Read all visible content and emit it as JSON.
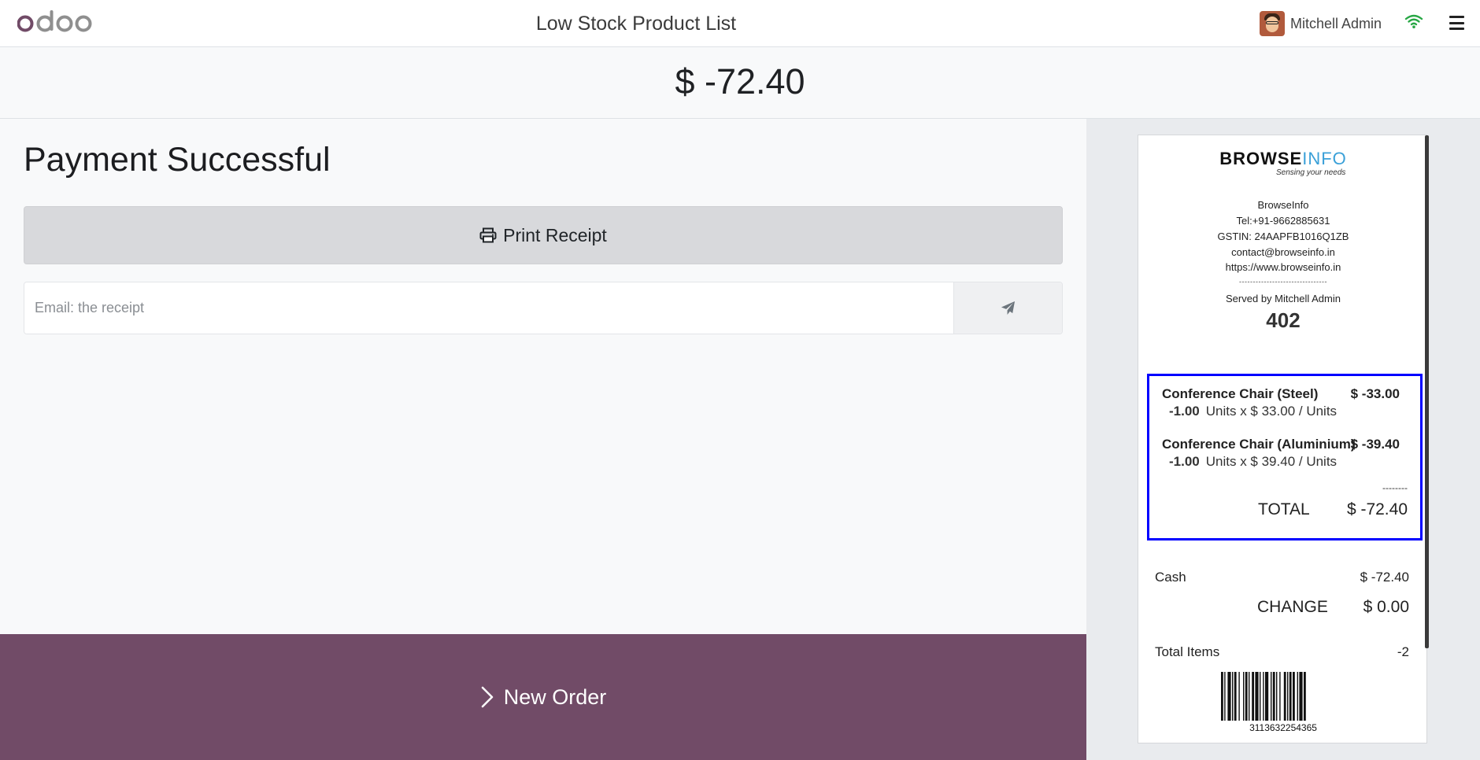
{
  "header": {
    "title": "Low Stock Product List",
    "user_name": "Mitchell Admin",
    "logo_text": "odoo"
  },
  "amount_due": "$ -72.40",
  "payment": {
    "title": "Payment Successful",
    "print_label": "Print Receipt",
    "email_placeholder": "Email: the receipt",
    "new_order_label": "New Order"
  },
  "receipt": {
    "brand_main": "BROWSE",
    "brand_accent": "INFO",
    "tagline": "Sensing your needs",
    "company_lines": [
      "BrowseInfo",
      "Tel:+91-9662885631",
      "GSTIN: 24AAPFB1016Q1ZB",
      "contact@browseinfo.in",
      "https://www.browseinfo.in"
    ],
    "divider": "--------------------------------",
    "served_by": "Served by Mitchell Admin",
    "order_number": "402",
    "lines": [
      {
        "product": "Conference Chair (Steel)",
        "price": "$ -33.00",
        "qty": "-1.00",
        "detail": "Units x $ 33.00 / Units"
      },
      {
        "product": "Conference Chair (Aluminium)",
        "price": "$ -39.40",
        "qty": "-1.00",
        "detail": "Units x $ 39.40 / Units"
      }
    ],
    "total_separator": "--------",
    "total_label": "TOTAL",
    "total_value": "$ -72.40",
    "payment_method": "Cash",
    "payment_value": "$ -72.40",
    "change_label": "CHANGE",
    "change_value": "$ 0.00",
    "total_items_label": "Total Items",
    "total_items_value": "-2",
    "barcode_number": "3113632254365"
  },
  "colors": {
    "brand_purple": "#714b67",
    "highlight_border": "#0000ff",
    "wifi_green": "#28a745",
    "info_blue": "#3aa0d8"
  },
  "icons": {
    "print": "print-icon",
    "send": "paper-plane-icon",
    "new_order": "chevron-right-icon",
    "wifi": "wifi-icon",
    "menu": "hamburger-menu-icon"
  }
}
